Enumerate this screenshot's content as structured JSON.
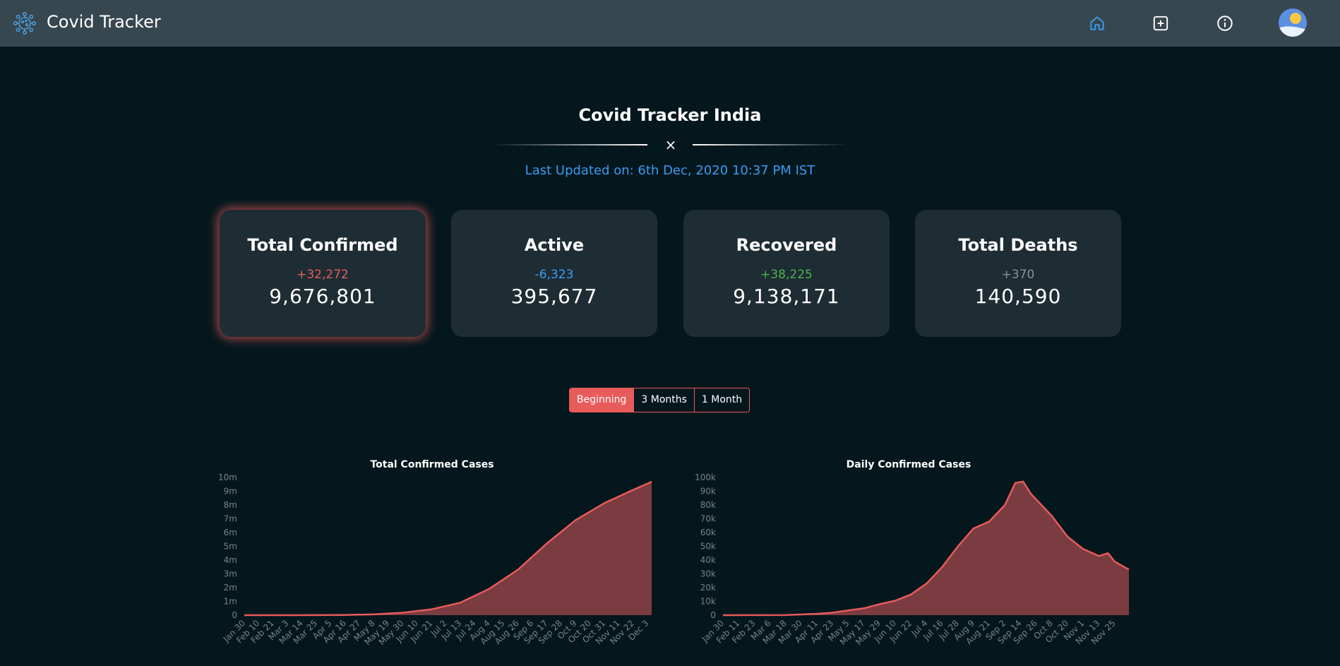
{
  "app": {
    "title": "Covid Tracker"
  },
  "nav": {
    "items": [
      {
        "name": "home",
        "icon": "home-icon",
        "color": "#3b9bf0"
      },
      {
        "name": "add",
        "icon": "plus-square-icon",
        "color": "#ffffff"
      },
      {
        "name": "info",
        "icon": "info-icon",
        "color": "#ffffff"
      }
    ],
    "avatar": "avatar"
  },
  "main": {
    "title": "Covid Tracker India",
    "divider_symbol": "×",
    "last_updated": "Last Updated on: 6th Dec, 2020 10:37 PM IST"
  },
  "cards": [
    {
      "title": "Total Confirmed",
      "delta": "+32,272",
      "value": "9,676,801",
      "delta_color": "#e85b5b"
    },
    {
      "title": "Active",
      "delta": "-6,323",
      "value": "395,677",
      "delta_color": "#3b9bf0"
    },
    {
      "title": "Recovered",
      "delta": "+38,225",
      "value": "9,138,171",
      "delta_color": "#4caf50"
    },
    {
      "title": "Total Deaths",
      "delta": "+370",
      "value": "140,590",
      "delta_color": "#8a9196"
    }
  ],
  "range_toggle": {
    "options": [
      "Beginning",
      "3 Months",
      "1 Month"
    ],
    "selected": "Beginning"
  },
  "colors": {
    "accent": "#e85b5b",
    "area_fill": "#7a3c40",
    "link": "#3b9bf0"
  },
  "chart_data": [
    {
      "type": "area",
      "title": "Total Confirmed Cases",
      "y_ticks": [
        "0",
        "1m",
        "2m",
        "3m",
        "4m",
        "5m",
        "6m",
        "7m",
        "8m",
        "9m",
        "10m"
      ],
      "ylim": [
        0,
        10000000
      ],
      "x_ticks": [
        "Jan 30",
        "Feb 10",
        "Feb 21",
        "Mar 3",
        "Mar 14",
        "Mar 25",
        "Apr 5",
        "Apr 16",
        "Apr 27",
        "May 8",
        "May 19",
        "May 30",
        "Jun 10",
        "Jun 21",
        "Jul 2",
        "Jul 13",
        "Jul 24",
        "Aug 4",
        "Aug 15",
        "Aug 26",
        "Sep 6",
        "Sep 17",
        "Sep 28",
        "Oct 9",
        "Oct 20",
        "Oct 31",
        "Nov 11",
        "Nov 22",
        "Dec 3"
      ],
      "series": [
        {
          "x": [
            "Jan 30",
            "Mar 14",
            "Apr 16",
            "May 8",
            "May 30",
            "Jun 21",
            "Jul 13",
            "Aug 4",
            "Aug 26",
            "Sep 17",
            "Oct 9",
            "Oct 31",
            "Nov 22",
            "Dec 6"
          ],
          "values": [
            0,
            100,
            13000,
            56000,
            182000,
            426000,
            907000,
            1910000,
            3310000,
            5210000,
            6910000,
            8140000,
            9100000,
            9680000
          ]
        }
      ]
    },
    {
      "type": "area",
      "title": "Daily Confirmed Cases",
      "y_ticks": [
        "0",
        "10k",
        "20k",
        "30k",
        "40k",
        "50k",
        "60k",
        "70k",
        "80k",
        "90k",
        "100k"
      ],
      "ylim": [
        0,
        100000
      ],
      "x_ticks": [
        "Jan 30",
        "Feb 11",
        "Feb 23",
        "Mar 6",
        "Mar 18",
        "Mar 30",
        "Apr 11",
        "Apr 23",
        "May 5",
        "May 17",
        "May 29",
        "Jun 10",
        "Jun 22",
        "Jul 4",
        "Jul 16",
        "Jul 28",
        "Aug 9",
        "Aug 21",
        "Sep 2",
        "Sep 14",
        "Sep 26",
        "Oct 8",
        "Oct 20",
        "Nov 1",
        "Nov 13",
        "Nov 25"
      ],
      "series": [
        {
          "x": [
            "Jan 30",
            "Mar 18",
            "Apr 11",
            "Apr 23",
            "May 5",
            "May 17",
            "May 29",
            "Jun 10",
            "Jun 22",
            "Jul 4",
            "Jul 16",
            "Jul 28",
            "Aug 9",
            "Aug 21",
            "Sep 2",
            "Sep 10",
            "Sep 16",
            "Sep 22",
            "Sep 30",
            "Oct 8",
            "Oct 20",
            "Nov 1",
            "Nov 13",
            "Nov 20",
            "Nov 25",
            "Dec 6"
          ],
          "values": [
            0,
            30,
            1000,
            1800,
            3500,
            5000,
            8000,
            10500,
            15000,
            23000,
            35000,
            50000,
            63000,
            68000,
            80000,
            96000,
            97000,
            88000,
            80000,
            72000,
            57000,
            48000,
            43000,
            45000,
            39000,
            33000
          ]
        }
      ]
    }
  ]
}
